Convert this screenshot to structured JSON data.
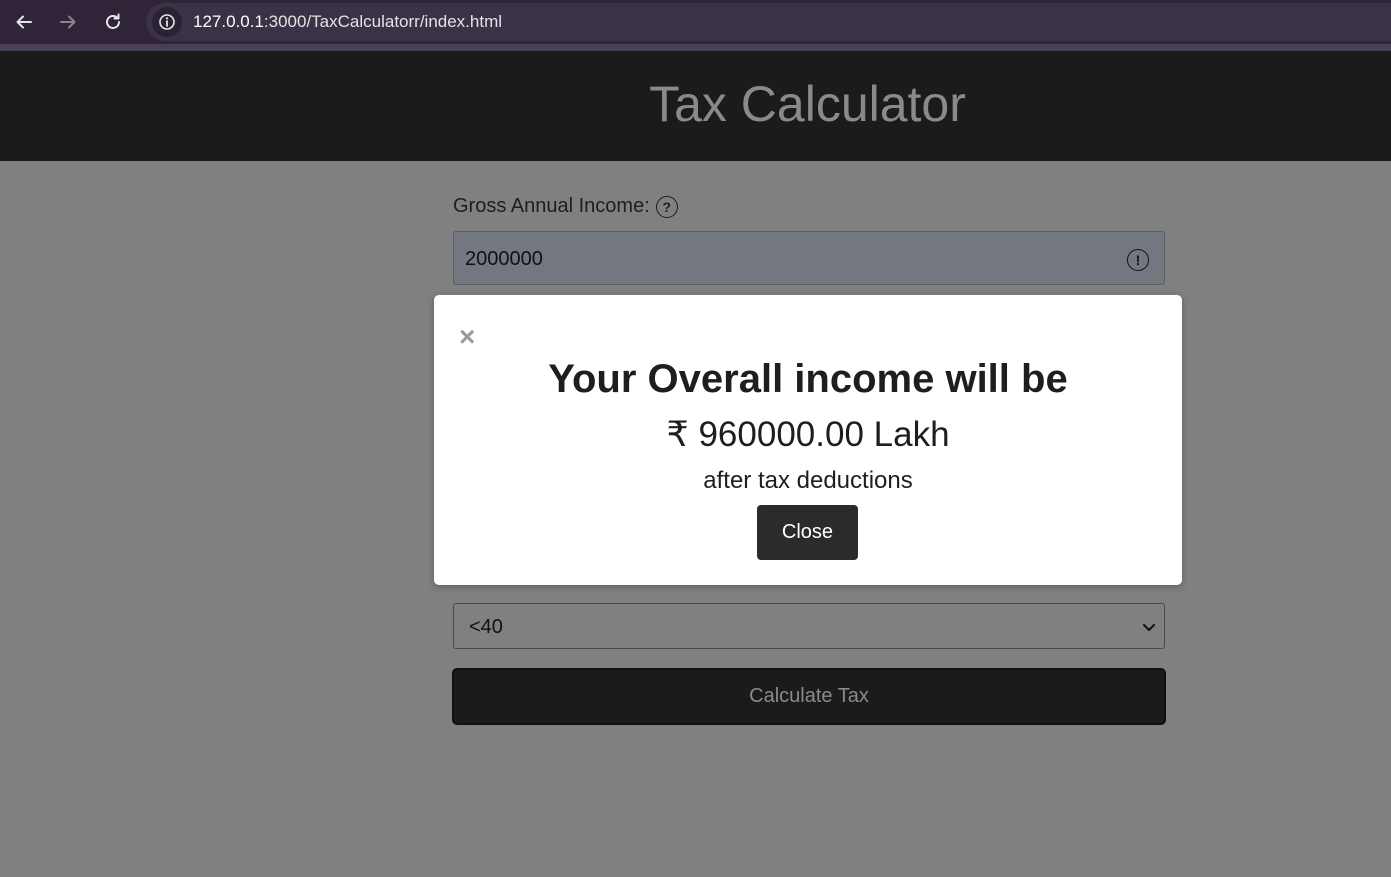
{
  "browser": {
    "url_host": "127.0.0.1",
    "url_path": ":3000/TaxCalculatorr/index.html",
    "icons": [
      "back-icon",
      "forward-icon",
      "reload-icon",
      "site-info-icon"
    ]
  },
  "header": {
    "title": "Tax Calculator"
  },
  "form": {
    "income_label": "Gross Annual Income:",
    "income_value": "2000000",
    "age_selected": "<40",
    "calculate_label": "Calculate Tax"
  },
  "modal": {
    "close_x": "×",
    "heading": "Your Overall income will be",
    "amount": "₹ 960000.00 Lakh",
    "subtext": "after tax deductions",
    "close_label": "Close"
  },
  "colors": {
    "browser_bar": "#2f2438",
    "header_bg": "#1b1b1b",
    "overlay_bg": "#808080",
    "modal_bg": "#ffffff",
    "button_dark": "#2b2b2b"
  }
}
